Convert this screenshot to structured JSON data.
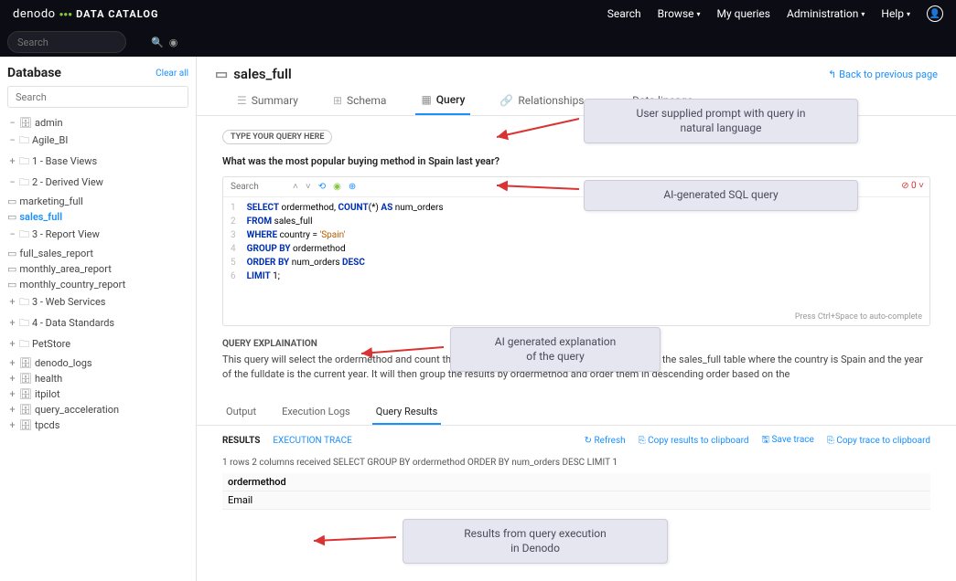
{
  "brand": {
    "name": "denodo",
    "product": "DATA CATALOG"
  },
  "topnav": {
    "search": "Search",
    "browse": "Browse",
    "myqueries": "My queries",
    "admin": "Administration",
    "help": "Help"
  },
  "searchPlaceholder": "Search",
  "sidebar": {
    "title": "Database",
    "clear": "Clear all",
    "searchPlaceholder": "Search",
    "tree": {
      "admin": "admin",
      "agile": "Agile_BI",
      "base": "1 - Base Views",
      "derived": "2 - Derived View",
      "mktg": "marketing_full",
      "sales": "sales_full",
      "report": "3 - Report View",
      "fsr": "full_sales_report",
      "mar": "monthly_area_report",
      "mcr": "monthly_country_report",
      "web": "3 - Web Services",
      "ds": "4 - Data Standards",
      "pet": "PetStore",
      "dlogs": "denodo_logs",
      "health": "health",
      "itpilot": "itpilot",
      "qa": "query_acceleration",
      "tpcds": "tpcds"
    }
  },
  "main": {
    "title": "sales_full",
    "back": "Back to previous page",
    "tabs": {
      "summary": "Summary",
      "schema": "Schema",
      "query": "Query",
      "rel": "Relationships",
      "lineage": "Data lineage"
    },
    "typeLabel": "TYPE YOUR QUERY HERE",
    "prompt": "What was the most popular buying method in Spain last year?",
    "codeSearch": "Search",
    "codeErr": "0",
    "sql": {
      "l1a": "SELECT",
      "l1b": " ordermethod, ",
      "l1c": "COUNT",
      "l1d": "(*) ",
      "l1e": "AS",
      "l1f": " num_orders",
      "l2a": "FROM",
      "l2b": " sales_full",
      "l3a": "WHERE",
      "l3b": " country = ",
      "l3c": "'Spain'",
      "l4a": "GROUP BY",
      "l4b": " ordermethod",
      "l5a": "ORDER BY",
      "l5b": " num_orders ",
      "l5c": "DESC",
      "l6a": "LIMIT",
      "l6b": " 1;"
    },
    "hint": "Press Ctrl+Space to auto-complete",
    "explHdr": "QUERY EXPLAINATION",
    "explTxt": "This query will select the ordermethod and count the number of orders for each ordermethod from the sales_full table where the country is Spain and the year of the fulldate is the current year. It will then group the results by ordermethod and order them in descending order based on the",
    "resTabs": {
      "output": "Output",
      "logs": "Execution Logs",
      "results": "Query Results"
    },
    "resBar": {
      "results": "RESULTS",
      "trace": "EXECUTION TRACE",
      "refresh": "Refresh",
      "copyRes": "Copy results to clipboard",
      "save": "Save trace",
      "copyTrace": "Copy trace to clipboard"
    },
    "resMeta": "1 rows 2 columns received   SELECT                                                                                                        GROUP BY ordermethod ORDER BY num_orders DESC LIMIT 1",
    "resCol": "ordermethod",
    "resVal": "Email"
  },
  "callouts": {
    "c1a": "User supplied prompt with query in",
    "c1b": "natural language",
    "c2": "AI-generated SQL query",
    "c3a": "AI generated explanation",
    "c3b": "of the query",
    "c4a": "Results from query execution",
    "c4b": "in Denodo"
  }
}
